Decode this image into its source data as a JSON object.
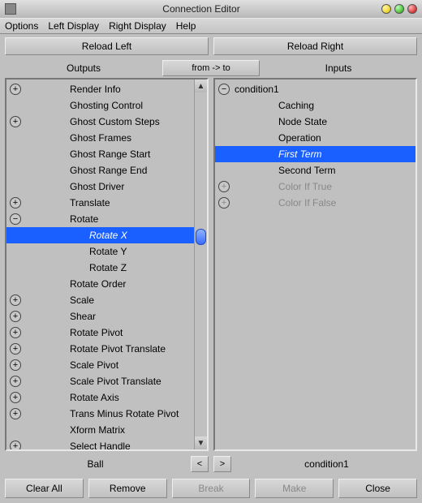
{
  "window": {
    "title": "Connection Editor"
  },
  "menu": {
    "options": "Options",
    "left_display": "Left Display",
    "right_display": "Right Display",
    "help": "Help"
  },
  "buttons": {
    "reload_left": "Reload Left",
    "reload_right": "Reload Right",
    "clear_all": "Clear All",
    "remove": "Remove",
    "break": "Break",
    "make": "Make",
    "close": "Close"
  },
  "labels": {
    "outputs": "Outputs",
    "inputs": "Inputs",
    "from_to": "from -> to"
  },
  "left": {
    "node_name": "Ball",
    "items": [
      {
        "label": "Render Info",
        "exp": "plus",
        "depth": 1
      },
      {
        "label": "Ghosting Control",
        "exp": "none",
        "depth": 1
      },
      {
        "label": "Ghost Custom Steps",
        "exp": "plus",
        "depth": 1
      },
      {
        "label": "Ghost Frames",
        "exp": "none",
        "depth": 1
      },
      {
        "label": "Ghost Range Start",
        "exp": "none",
        "depth": 1
      },
      {
        "label": "Ghost Range End",
        "exp": "none",
        "depth": 1
      },
      {
        "label": "Ghost Driver",
        "exp": "none",
        "depth": 1
      },
      {
        "label": "Translate",
        "exp": "plus",
        "depth": 1
      },
      {
        "label": "Rotate",
        "exp": "minus",
        "depth": 1
      },
      {
        "label": "Rotate X",
        "exp": "none",
        "depth": 2,
        "selected": true
      },
      {
        "label": "Rotate Y",
        "exp": "none",
        "depth": 2
      },
      {
        "label": "Rotate Z",
        "exp": "none",
        "depth": 2
      },
      {
        "label": "Rotate Order",
        "exp": "none",
        "depth": 1
      },
      {
        "label": "Scale",
        "exp": "plus",
        "depth": 1
      },
      {
        "label": "Shear",
        "exp": "plus",
        "depth": 1
      },
      {
        "label": "Rotate Pivot",
        "exp": "plus",
        "depth": 1
      },
      {
        "label": "Rotate Pivot Translate",
        "exp": "plus",
        "depth": 1
      },
      {
        "label": "Scale Pivot",
        "exp": "plus",
        "depth": 1
      },
      {
        "label": "Scale Pivot Translate",
        "exp": "plus",
        "depth": 1
      },
      {
        "label": "Rotate Axis",
        "exp": "plus",
        "depth": 1
      },
      {
        "label": "Trans Minus Rotate Pivot",
        "exp": "plus",
        "depth": 1
      },
      {
        "label": "Xform Matrix",
        "exp": "none",
        "depth": 1
      },
      {
        "label": "Select Handle",
        "exp": "plus",
        "depth": 1
      }
    ]
  },
  "right": {
    "node_name": "condition1",
    "header": "condition1",
    "items": [
      {
        "label": "Caching",
        "exp": "none",
        "depth": 1
      },
      {
        "label": "Node State",
        "exp": "none",
        "depth": 1
      },
      {
        "label": "Operation",
        "exp": "none",
        "depth": 1
      },
      {
        "label": "First Term",
        "exp": "none",
        "depth": 1,
        "selected": true
      },
      {
        "label": "Second Term",
        "exp": "none",
        "depth": 1
      },
      {
        "label": "Color If True",
        "exp": "plus",
        "depth": 1,
        "dim": true
      },
      {
        "label": "Color If False",
        "exp": "plus",
        "depth": 1,
        "dim": true
      }
    ]
  }
}
